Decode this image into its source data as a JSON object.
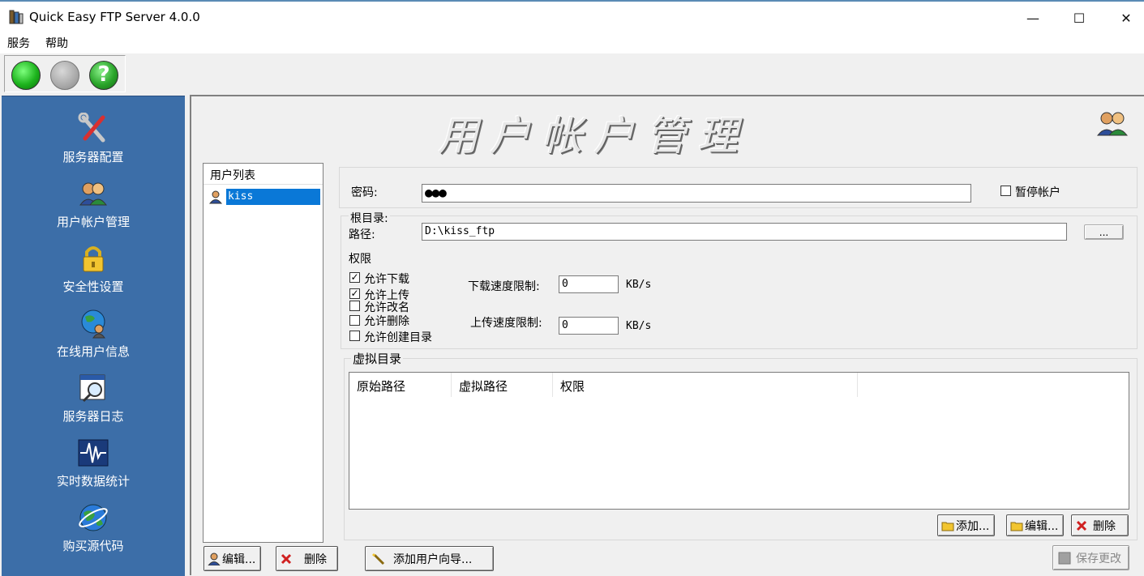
{
  "window": {
    "title": "Quick Easy FTP Server 4.0.0",
    "minimize": "—",
    "maximize": "☐",
    "close": "✕"
  },
  "menu": {
    "items": [
      "服务",
      "帮助"
    ]
  },
  "toolbar": {
    "buttons": [
      "start-green",
      "stop-gray",
      "help"
    ],
    "help_glyph": "?"
  },
  "sidebar": {
    "items": [
      {
        "label": "服务器配置",
        "icon": "tools-icon"
      },
      {
        "label": "用户帐户管理",
        "icon": "users-icon"
      },
      {
        "label": "安全性设置",
        "icon": "lock-icon"
      },
      {
        "label": "在线用户信息",
        "icon": "globe-users-icon"
      },
      {
        "label": "服务器日志",
        "icon": "log-magnifier-icon"
      },
      {
        "label": "实时数据统计",
        "icon": "pulse-icon"
      },
      {
        "label": "购买源代码",
        "icon": "globe-icon"
      }
    ]
  },
  "page": {
    "banner": "用户帐户管理"
  },
  "userlist": {
    "header": "用户列表",
    "users": [
      "kiss"
    ]
  },
  "form": {
    "password_label": "密码:",
    "password_value": "●●●",
    "suspend_label": "暂停帐户",
    "suspend_checked": false,
    "root_group_label": "根目录:",
    "path_label": "路径:",
    "path_value": "D:\\kiss_ftp",
    "browse_label": "...",
    "perm_label": "权限",
    "permissions": [
      {
        "label": "允许下载",
        "checked": true
      },
      {
        "label": "允许上传",
        "checked": true
      },
      {
        "label": "允许改名",
        "checked": false
      },
      {
        "label": "允许删除",
        "checked": false
      },
      {
        "label": "允许创建目录",
        "checked": false
      }
    ],
    "download_limit_label": "下载速度限制:",
    "download_limit_value": "0",
    "upload_limit_label": "上传速度限制:",
    "upload_limit_value": "0",
    "unit": "KB/s",
    "check_mark": "✓"
  },
  "vdir": {
    "label": "虚拟目录",
    "columns": [
      "原始路径",
      "虚拟路径",
      "权限"
    ],
    "add_label": "添加...",
    "edit_label": "编辑...",
    "delete_label": "删除"
  },
  "bottom": {
    "edit_label": "编辑...",
    "delete_label": "删除",
    "wizard_label": "添加用户向导...",
    "save_label": "保存更改"
  },
  "colors": {
    "sidebar": "#3c6ea8",
    "selection": "#0a78d7",
    "start": "#1db31d",
    "help": "#2aa52a"
  }
}
